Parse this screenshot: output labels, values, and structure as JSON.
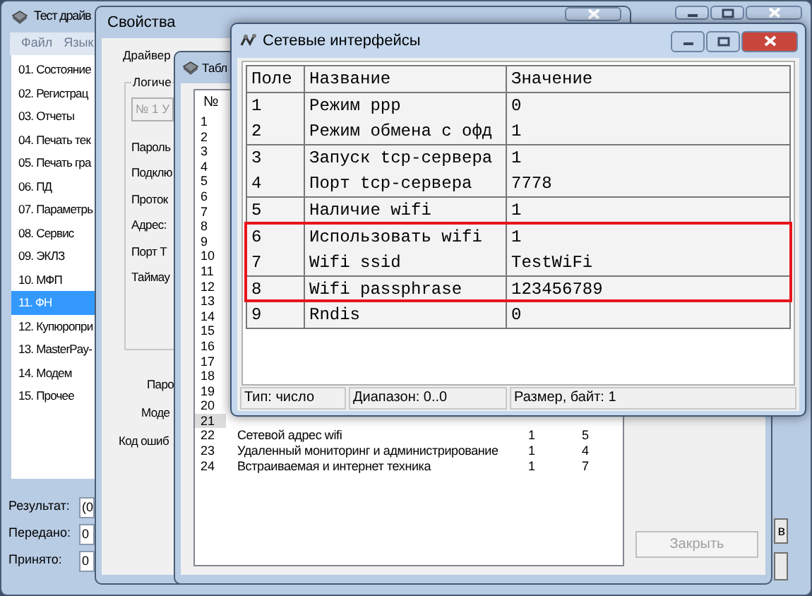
{
  "main_window": {
    "title": "Тест драйв",
    "menu": [
      "Файл",
      "Язык"
    ],
    "nav_items": [
      {
        "label": "01. Состояние",
        "selected": false
      },
      {
        "label": "02. Регистрац",
        "selected": false
      },
      {
        "label": "03. Отчеты",
        "selected": false
      },
      {
        "label": "04. Печать тек",
        "selected": false
      },
      {
        "label": "05. Печать гра",
        "selected": false
      },
      {
        "label": "06. ПД",
        "selected": false
      },
      {
        "label": "07. Параметрь",
        "selected": false
      },
      {
        "label": "08. Сервис",
        "selected": false
      },
      {
        "label": "09. ЭКЛЗ",
        "selected": false
      },
      {
        "label": "10. МФП",
        "selected": false
      },
      {
        "label": "11. ФН",
        "selected": true
      },
      {
        "label": "12. Купюропри",
        "selected": false
      },
      {
        "label": "13. MasterPay-",
        "selected": false
      },
      {
        "label": "14. Модем",
        "selected": false
      },
      {
        "label": "15. Прочее",
        "selected": false
      }
    ],
    "fields": [
      {
        "label": "Результат:",
        "value": "(0"
      },
      {
        "label": "Передано:",
        "value": "0"
      },
      {
        "label": "Принято:",
        "value": "0"
      }
    ],
    "side_button": "в"
  },
  "properties_window": {
    "title": "Свойства",
    "tab": "Драйвер",
    "group": "Логиче",
    "device_field": "№ 1 У",
    "labels": [
      "Пароль",
      "Подклю",
      "Проток",
      "Адрес:",
      "Порт Т",
      "Таймау"
    ],
    "lower_labels": [
      "Паро",
      "Моде",
      "Код ошиб"
    ]
  },
  "table_window": {
    "title": "Табл",
    "column_1": "№",
    "rows": [
      {
        "number": "1",
        "selected": false
      },
      {
        "number": "2",
        "selected": false
      },
      {
        "number": "3",
        "selected": false
      },
      {
        "number": "4",
        "selected": false
      },
      {
        "number": "5",
        "selected": false
      },
      {
        "number": "6",
        "selected": false
      },
      {
        "number": "7",
        "selected": false
      },
      {
        "number": "8",
        "selected": false
      },
      {
        "number": "9",
        "selected": false
      },
      {
        "number": "10",
        "selected": false
      },
      {
        "number": "11",
        "selected": false
      },
      {
        "number": "12",
        "selected": false
      },
      {
        "number": "13",
        "selected": false
      },
      {
        "number": "14",
        "selected": false
      },
      {
        "number": "15",
        "selected": false
      },
      {
        "number": "16",
        "selected": false
      },
      {
        "number": "17",
        "selected": false
      },
      {
        "number": "18",
        "selected": false
      },
      {
        "number": "19",
        "selected": false
      },
      {
        "number": "20",
        "selected": false
      },
      {
        "number": "21",
        "selected": true
      },
      {
        "number": "22",
        "name": "Сетевой адрес wifi",
        "column_3": "1",
        "column_4": "5",
        "selected": false
      },
      {
        "number": "23",
        "name": "Удаленный мониторинг и администрирование",
        "column_3": "1",
        "column_4": "4",
        "selected": false
      },
      {
        "number": "24",
        "name": "Встраиваемая и интернет техника",
        "column_3": "1",
        "column_4": "7",
        "selected": false
      }
    ],
    "close_button": {
      "label": "Закрыть",
      "disabled": true
    }
  },
  "network_window": {
    "title": "Сетевые интерфейсы",
    "columns": [
      "Поле",
      "Название",
      "Значение"
    ],
    "rows": [
      {
        "field": "1",
        "name": "Режим ppp",
        "value": "0",
        "highlighted": false
      },
      {
        "field": "2",
        "name": "Режим обмена с офд",
        "value": "1",
        "highlighted": false
      },
      {
        "field": "3",
        "name": "Запуск tcp-сервера",
        "value": "1",
        "highlighted": false
      },
      {
        "field": "4",
        "name": "Порт tcp-сервера",
        "value": "7778",
        "highlighted": false
      },
      {
        "field": "5",
        "name": "Наличие wifi",
        "value": "1",
        "highlighted": false
      },
      {
        "field": "6",
        "name": "Использовать wifi",
        "value": "1",
        "highlighted": true
      },
      {
        "field": "7",
        "name": "Wifi ssid",
        "value": "TestWiFi",
        "highlighted": true
      },
      {
        "field": "8",
        "name": "Wifi passphrase",
        "value": "123456789",
        "highlighted": true
      },
      {
        "field": "9",
        "name": "Rndis",
        "value": "0",
        "highlighted": false
      }
    ],
    "status_bar": [
      "Тип: число",
      "Диапазон: 0..0",
      "Размер, байт: 1"
    ]
  }
}
